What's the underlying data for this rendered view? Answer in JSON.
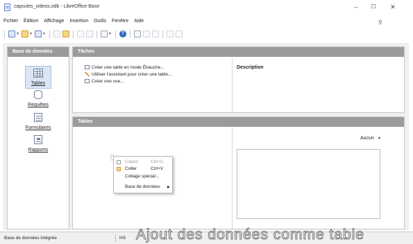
{
  "window": {
    "title": "capsules_videos.odb - LibreOffice Base",
    "minimize": "–",
    "maximize": "☐",
    "close": "✕"
  },
  "menubar": [
    "Fichier",
    "Édition",
    "Affichage",
    "Insertion",
    "Outils",
    "Fenêtre",
    "Aide"
  ],
  "database_pane": {
    "header": "Base de données",
    "items": [
      {
        "label": "Tables",
        "icon": "table-icon",
        "selected": true
      },
      {
        "label": "Requêtes",
        "icon": "query-icon",
        "selected": false
      },
      {
        "label": "Formulaires",
        "icon": "form-icon",
        "selected": false
      },
      {
        "label": "Rapports",
        "icon": "report-icon",
        "selected": false
      }
    ]
  },
  "tasks_pane": {
    "header": "Tâches",
    "tasks": [
      "Créer une table en mode Ébauche...",
      "Utiliser l'assistant pour créer une table...",
      "Créer une vue..."
    ],
    "description_label": "Description"
  },
  "tables_pane": {
    "header": "Tables",
    "preview_select": "Aucun"
  },
  "context_menu": {
    "items": [
      {
        "label": "Copier",
        "shortcut": "Ctrl+C",
        "enabled": false
      },
      {
        "label": "Coller",
        "shortcut": "Ctrl+V",
        "enabled": true
      },
      {
        "label": "Collage spécial...",
        "shortcut": "",
        "enabled": true
      },
      {
        "label": "Base de données",
        "shortcut": "",
        "enabled": true,
        "submenu": true
      }
    ]
  },
  "statusbar": {
    "text": "Base de données intégrée",
    "engine": "HS"
  },
  "caption": "Ajout des données comme table",
  "colors": {
    "pane_header": "#9b9b9b",
    "selection": "#dbe6f5",
    "help_icon": "#2e67c3"
  }
}
